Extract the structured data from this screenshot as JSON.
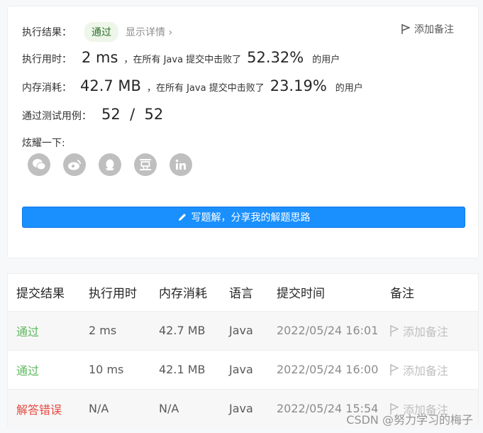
{
  "result": {
    "status_label": "执行结果：",
    "status_value": "通过",
    "detail_link": "显示详情 ›",
    "add_note": "添加备注",
    "runtime_label": "执行用时：",
    "runtime_value": "2 ms",
    "runtime_prefix": "，在所有 Java 提交中击败了",
    "runtime_pct": "52.32%",
    "users_suffix": "的用户",
    "memory_label": "内存消耗：",
    "memory_value": "42.7 MB",
    "memory_prefix": "，在所有 Java 提交中击败了",
    "memory_pct": "23.19%",
    "tests_label": "通过测试用例：",
    "tests_value": "52  /  52",
    "share_label": "炫耀一下:",
    "share_icons": [
      "wechat-icon",
      "weibo-icon",
      "qq-icon",
      "douban-icon",
      "linkedin-icon"
    ],
    "write_button": "写题解，分享我的解题思路"
  },
  "table": {
    "headers": [
      "提交结果",
      "执行用时",
      "内存消耗",
      "语言",
      "提交时间",
      "备注"
    ],
    "rows": [
      {
        "status": "通过",
        "runtime": "2 ms",
        "memory": "42.7 MB",
        "lang": "Java",
        "time": "2022/05/24 16:01",
        "note": "添加备注"
      },
      {
        "status": "通过",
        "runtime": "10 ms",
        "memory": "42.1 MB",
        "lang": "Java",
        "time": "2022/05/24 16:00",
        "note": "添加备注"
      },
      {
        "status": "解答错误",
        "runtime": "N/A",
        "memory": "N/A",
        "lang": "Java",
        "time": "2022/05/24 15:54",
        "note": "添加备注"
      }
    ]
  },
  "watermark": "CSDN @努力学习的梅子",
  "colors": {
    "accent": "#1a90ff",
    "pass": "#5cb85c",
    "fail": "#e5493f"
  }
}
